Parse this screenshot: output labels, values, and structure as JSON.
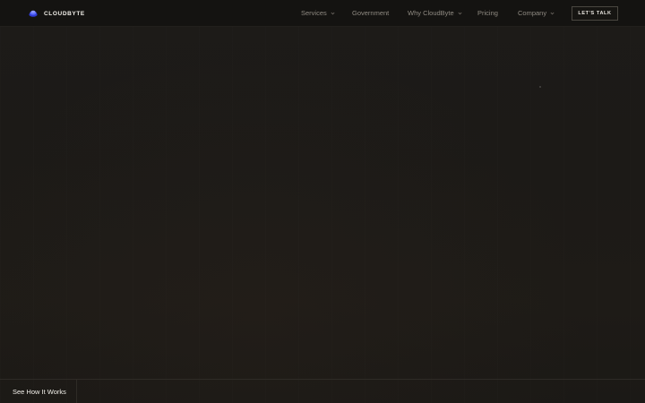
{
  "brand": {
    "name": "CLOUDBYTE",
    "logo_icon": "cloud-stack-icon",
    "logo_colors": [
      "#5b6cff",
      "#2f3bd6"
    ]
  },
  "nav": {
    "items": [
      {
        "label": "Services",
        "has_dropdown": true
      },
      {
        "label": "Government",
        "has_dropdown": false
      },
      {
        "label": "Why CloudByte",
        "has_dropdown": true
      },
      {
        "label": "Pricing",
        "has_dropdown": false
      },
      {
        "label": "Company",
        "has_dropdown": true
      }
    ],
    "cta_label": "LET'S TALK"
  },
  "hero": {
    "see_how_label": "See How It Works"
  },
  "colors": {
    "background": "#1c1a17",
    "navbar": "#141311",
    "nav_text": "#8f8a82",
    "text_primary": "#f1efe9"
  }
}
